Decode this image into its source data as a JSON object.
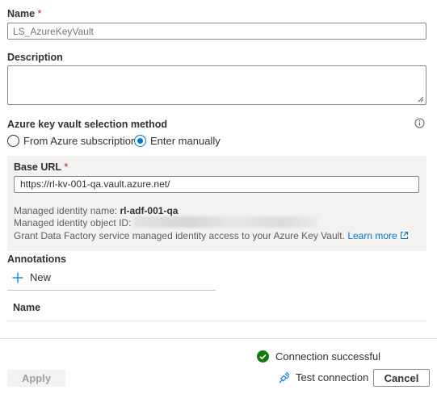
{
  "name": {
    "label": "Name",
    "required": "*",
    "placeholder": "LS_AzureKeyVault"
  },
  "description": {
    "label": "Description",
    "value": ""
  },
  "selection": {
    "label": "Azure key vault selection method",
    "options": [
      "From Azure subscription",
      "Enter manually"
    ],
    "selected": "Enter manually",
    "info_icon": "info-icon"
  },
  "base_url": {
    "label": "Base URL",
    "required": "*",
    "value": "https://rl-kv-001-qa.vault.azure.net/"
  },
  "managed_identity": {
    "name_label": "Managed identity name:",
    "name_value": "rl-adf-001-qa",
    "object_id_label": "Managed identity object ID:",
    "grant_text": "Grant Data Factory service managed identity access to your Azure Key Vault.",
    "learn_more": "Learn more"
  },
  "annotations": {
    "label": "Annotations",
    "new_label": "New",
    "column_header": "Name"
  },
  "footer": {
    "status_text": "Connection successful",
    "apply_label": "Apply",
    "test_label": "Test connection",
    "cancel_label": "Cancel"
  },
  "colors": {
    "accent": "#0078d4",
    "success": "#107c10",
    "required": "#a4262c",
    "panel": "#f3f2f1"
  }
}
